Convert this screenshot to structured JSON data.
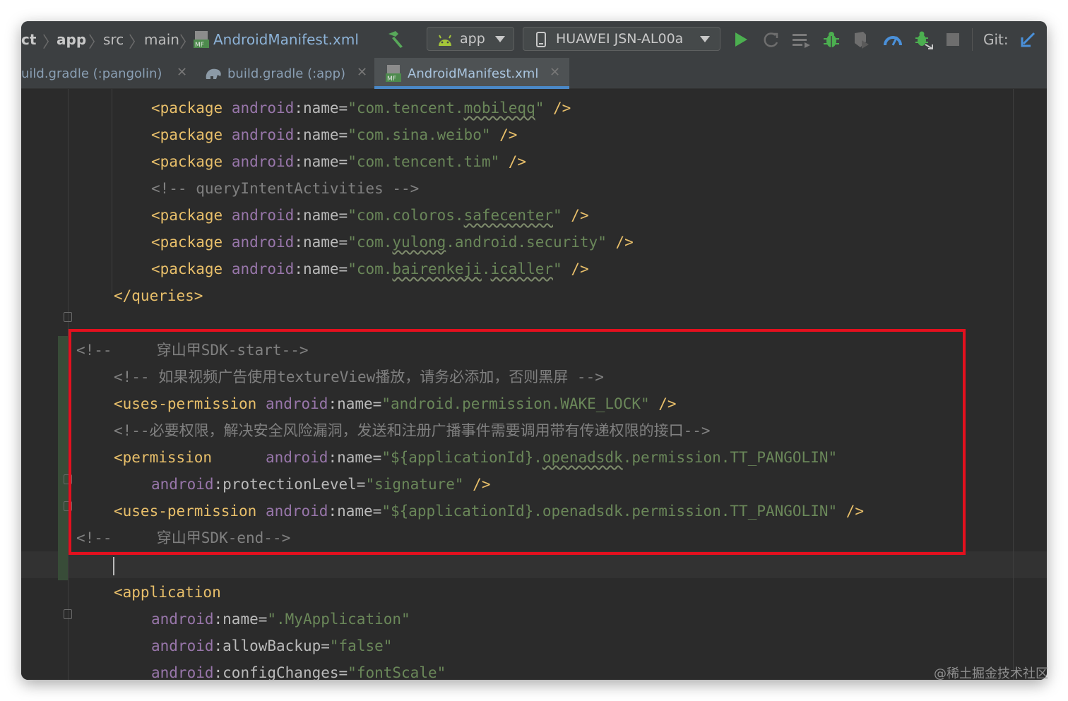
{
  "toolbar": {
    "breadcrumb": [
      "ct",
      "app",
      "src",
      "main",
      "AndroidManifest.xml"
    ],
    "run_config": "app",
    "device": "HUAWEI JSN-AL00a",
    "vcs_label": "Git:"
  },
  "tabs": [
    {
      "label": "uild.gradle (:pangolin)",
      "active": false
    },
    {
      "label": "build.gradle (:app)",
      "active": false
    },
    {
      "label": "AndroidManifest.xml",
      "active": true
    }
  ],
  "file_badge": "MF",
  "code": {
    "pkg1": {
      "tag": "<package",
      "ns": "android",
      "attr": ":name=",
      "q1": "\"com.tencent.",
      "u": "mobileqq",
      "q2": "\"",
      "end": " />"
    },
    "pkg2": {
      "tag": "<package",
      "ns": "android",
      "attr": ":name=",
      "val": "\"com.sina.weibo\"",
      "end": " />"
    },
    "pkg3": {
      "tag": "<package",
      "ns": "android",
      "attr": ":name=",
      "val": "\"com.tencent.tim\"",
      "end": " />"
    },
    "cmt_query": "<!-- queryIntentActivities -->",
    "pkg4": {
      "tag": "<package",
      "ns": "android",
      "attr": ":name=",
      "q1": "\"com.coloros.",
      "u": "safecenter",
      "q2": "\"",
      "end": " />"
    },
    "pkg5": {
      "tag": "<package",
      "ns": "android",
      "attr": ":name=",
      "q1": "\"com.",
      "u": "yulong",
      "q2": ".android.security\"",
      "end": " />"
    },
    "pkg6": {
      "tag": "<package",
      "ns": "android",
      "attr": ":name=",
      "q1": "\"com.",
      "u1": "bairenkeji",
      "dot": ".",
      "u2": "icaller",
      "q2": "\"",
      "end": " />"
    },
    "queries_close": "</queries>",
    "cmt_start": "<!--     穿山甲SDK-start-->",
    "cmt_texture": "<!-- 如果视频广告使用textureView播放，请务必添加，否则黑屏 -->",
    "perm_wake": {
      "tag": "<uses-permission",
      "ns": "android",
      "attr": ":name=",
      "val": "\"android.permission.WAKE_LOCK\"",
      "end": " />"
    },
    "cmt_required": "<!--必要权限，解决安全风险漏洞，发送和注册广播事件需要调用带有传递权限的接口-->",
    "perm_def": {
      "tag": "<permission",
      "pad": "      ",
      "ns": "android",
      "attr": ":name=",
      "q1": "\"${applicationId}.",
      "u": "openadsdk",
      "q2": ".permission.TT_PANGOLIN\""
    },
    "prot_level": {
      "ns": "android",
      "attr": ":protectionLevel=",
      "val": "\"signature\"",
      "end": " />"
    },
    "perm_use": {
      "tag": "<uses-permission",
      "ns": "android",
      "attr": ":name=",
      "val": "\"${applicationId}.openadsdk.permission.TT_PANGOLIN\"",
      "end": " />"
    },
    "cmt_end": "<!--     穿山甲SDK-end-->",
    "app_open": "<application",
    "app_name": {
      "ns": "android",
      "attr": ":name=",
      "val": "\".MyApplication\""
    },
    "app_backup": {
      "ns": "android",
      "attr": ":allowBackup=",
      "val": "\"false\""
    },
    "app_config": {
      "ns": "android",
      "attr": ":configChanges=",
      "val": "\"fontScale\""
    }
  },
  "watermark": "@稀土掘金技术社区",
  "colors": {
    "tag": "#e8bf6a",
    "namespace": "#9876aa",
    "value": "#6a8759",
    "comment": "#808080",
    "highlight_box": "#e3101e",
    "run": "#4caf50"
  }
}
